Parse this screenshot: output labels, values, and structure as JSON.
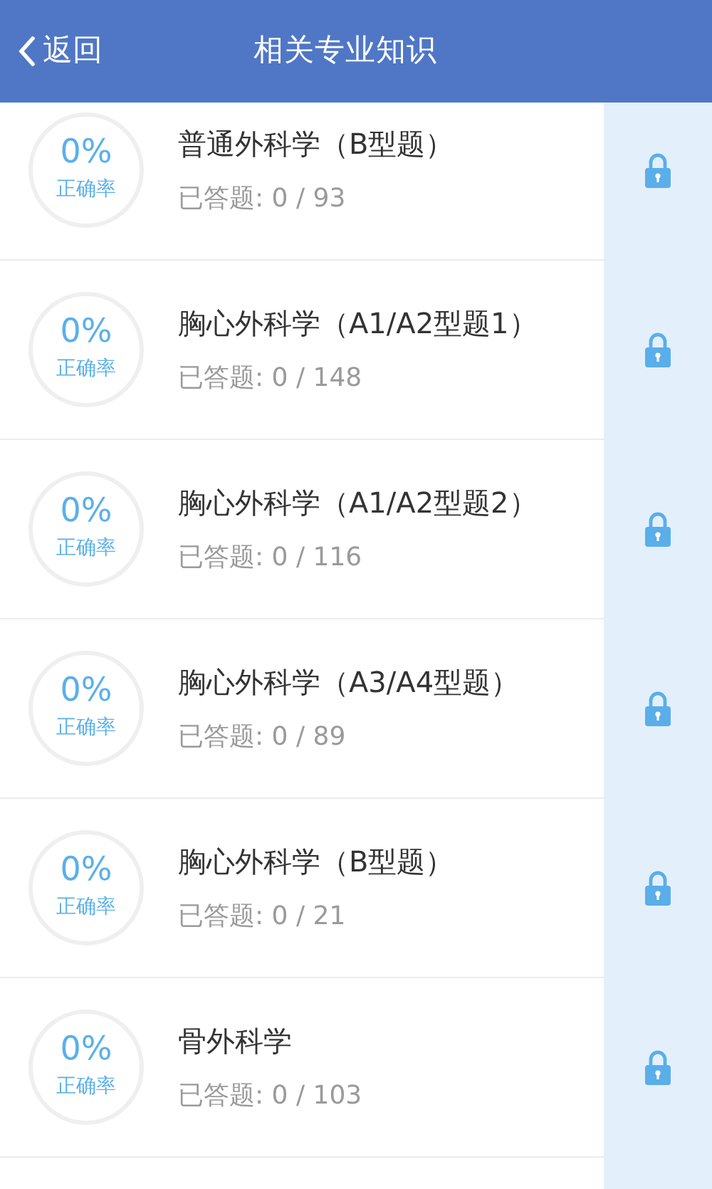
{
  "header": {
    "back": "返回",
    "title": "相关专业知识"
  },
  "items": [
    {
      "rate": "0%",
      "rate_label": "正确率",
      "title": "普通外科学（B型题）",
      "progress": "已答题: 0 / 93",
      "locked": true
    },
    {
      "rate": "0%",
      "rate_label": "正确率",
      "title": "胸心外科学（A1/A2型题1）",
      "progress": "已答题: 0 / 148",
      "locked": true
    },
    {
      "rate": "0%",
      "rate_label": "正确率",
      "title": "胸心外科学（A1/A2型题2）",
      "progress": "已答题: 0 / 116",
      "locked": true
    },
    {
      "rate": "0%",
      "rate_label": "正确率",
      "title": "胸心外科学（A3/A4型题）",
      "progress": "已答题: 0 / 89",
      "locked": true
    },
    {
      "rate": "0%",
      "rate_label": "正确率",
      "title": "胸心外科学（B型题）",
      "progress": "已答题: 0 / 21",
      "locked": true
    },
    {
      "rate": "0%",
      "rate_label": "正确率",
      "title": "骨外科学",
      "progress": "已答题: 0 / 103",
      "locked": true
    }
  ]
}
